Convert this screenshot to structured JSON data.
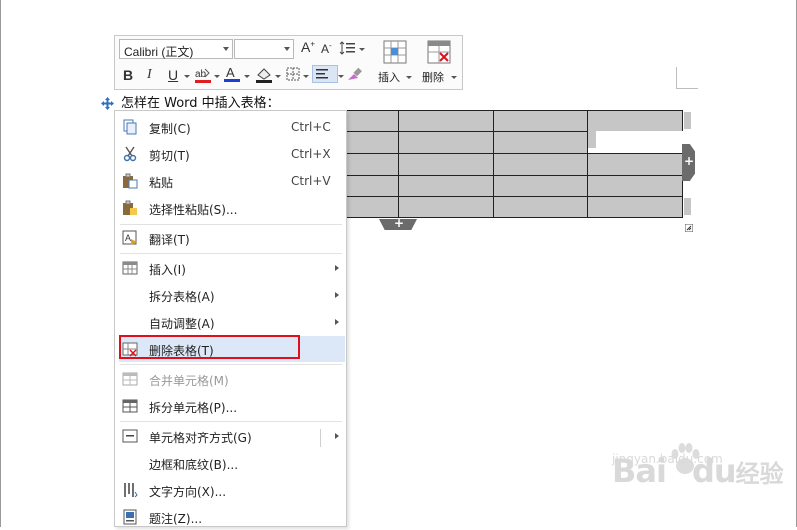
{
  "mini_toolbar": {
    "font_name": "Calibri (正文)",
    "font_size": "",
    "insert_label": "插入",
    "delete_label": "删除",
    "bold": "B",
    "italic": "I",
    "underline": "U"
  },
  "document": {
    "paragraph": "怎样在 Word 中插入表格："
  },
  "table": {
    "rows": 5,
    "cols": 4,
    "cell_fill": "#c6c6c6"
  },
  "context_menu": {
    "items": [
      {
        "label": "复制(C)",
        "shortcut": "Ctrl+C",
        "icon": "copy-icon"
      },
      {
        "label": "剪切(T)",
        "shortcut": "Ctrl+X",
        "icon": "scissors-icon"
      },
      {
        "label": "粘贴",
        "shortcut": "Ctrl+V",
        "icon": "paste-icon"
      },
      {
        "label": "选择性粘贴(S)...",
        "icon": "paste-special-icon"
      },
      {
        "label": "翻译(T)",
        "icon": "translate-icon"
      },
      {
        "label": "插入(I)",
        "icon": "table-insert-icon",
        "submenu": true
      },
      {
        "label": "拆分表格(A)",
        "submenu": true
      },
      {
        "label": "自动调整(A)",
        "submenu": true
      },
      {
        "label": "删除表格(T)",
        "icon": "table-delete-icon",
        "highlighted": true
      },
      {
        "label": "合并单元格(M)",
        "icon": "merge-cells-icon",
        "disabled": true
      },
      {
        "label": "拆分单元格(P)...",
        "icon": "split-cells-icon"
      },
      {
        "label": "单元格对齐方式(G)",
        "icon": "cell-align-icon",
        "submenu": true
      },
      {
        "label": "边框和底纹(B)..."
      },
      {
        "label": "文字方向(X)...",
        "icon": "text-direction-icon"
      },
      {
        "label": "题注(Z)...",
        "icon": "caption-icon"
      }
    ]
  },
  "colors": {
    "highlight_border": "#e0101a",
    "highlight_fill": "#dce8f8",
    "font_color_bar": "#1f3fd0",
    "highlight_bar": "#e02020"
  },
  "watermark": {
    "brand": "Bai",
    "brand2": "du",
    "text": "经验",
    "url": "jingyan.baidu.com"
  }
}
